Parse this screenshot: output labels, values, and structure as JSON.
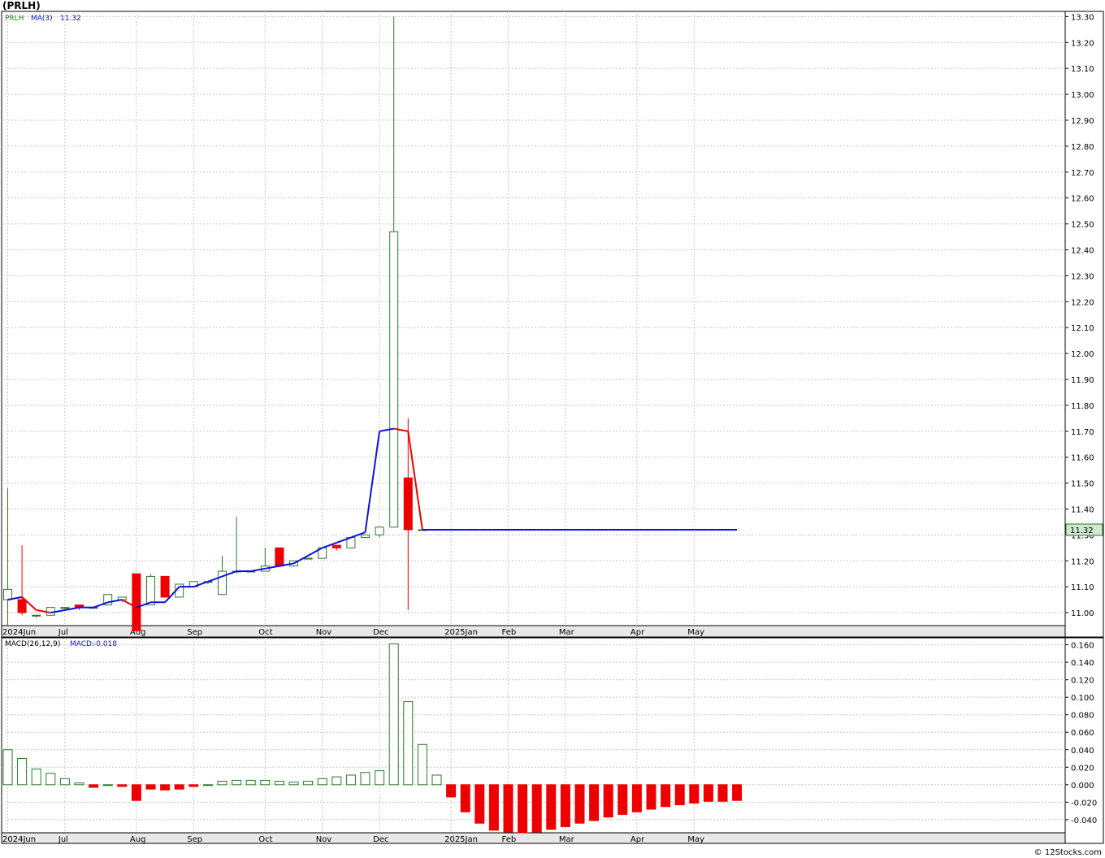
{
  "title": "(PRLH)",
  "footer": "© 12Stocks.com",
  "colors": {
    "up": "#2a7a2a",
    "down": "#ee0000",
    "ma_up": "#1010dd",
    "ma_down": "#ee0000",
    "grid": "#c8c8c8",
    "axis_bg": "#e8e8e8"
  },
  "price_legend": {
    "symbol": "PRLH",
    "ma": "MA(3)",
    "ma_value": "11.32"
  },
  "macd_legend": {
    "params": "MACD(26,12,9)",
    "label": "MACD:",
    "value": "-0.018"
  },
  "last_price_label": "11.32",
  "x_labels": [
    {
      "t": "2024Jun",
      "i": 0
    },
    {
      "t": "Jul",
      "i": 4
    },
    {
      "t": "Aug",
      "i": 9
    },
    {
      "t": "Sep",
      "i": 13
    },
    {
      "t": "Oct",
      "i": 18
    },
    {
      "t": "Nov",
      "i": 22
    },
    {
      "t": "Dec",
      "i": 26
    },
    {
      "t": "2025Jan",
      "i": 31
    },
    {
      "t": "Feb",
      "i": 35
    },
    {
      "t": "Mar",
      "i": 39
    },
    {
      "t": "Apr",
      "i": 44
    },
    {
      "t": "May",
      "i": 48
    }
  ],
  "chart_data": [
    {
      "type": "candlestick",
      "name": "price",
      "ylim": [
        10.95,
        13.32
      ],
      "yticks": [
        "11.00",
        "11.10",
        "11.20",
        "11.30",
        "11.40",
        "11.50",
        "11.60",
        "11.70",
        "11.80",
        "11.90",
        "12.00",
        "12.10",
        "12.20",
        "12.30",
        "12.40",
        "12.50",
        "12.60",
        "12.70",
        "12.80",
        "12.90",
        "13.00",
        "13.10",
        "13.20",
        "13.30"
      ],
      "candles": [
        {
          "i": 0,
          "o": 11.05,
          "h": 11.48,
          "l": 10.95,
          "c": 11.09
        },
        {
          "i": 1,
          "o": 11.05,
          "h": 11.26,
          "l": 10.99,
          "c": 11.0
        },
        {
          "i": 2,
          "o": 10.99,
          "h": 10.99,
          "l": 10.98,
          "c": 10.99
        },
        {
          "i": 3,
          "o": 10.99,
          "h": 11.02,
          "l": 10.99,
          "c": 11.02
        },
        {
          "i": 4,
          "o": 11.02,
          "h": 11.02,
          "l": 11.01,
          "c": 11.02
        },
        {
          "i": 5,
          "o": 11.03,
          "h": 11.03,
          "l": 11.01,
          "c": 11.02
        },
        {
          "i": 6,
          "o": 11.02,
          "h": 11.02,
          "l": 11.02,
          "c": 11.02
        },
        {
          "i": 7,
          "o": 11.03,
          "h": 11.07,
          "l": 11.03,
          "c": 11.07
        },
        {
          "i": 8,
          "o": 11.05,
          "h": 11.06,
          "l": 11.04,
          "c": 11.06
        },
        {
          "i": 9,
          "o": 11.15,
          "h": 11.15,
          "l": 10.93,
          "c": 10.93
        },
        {
          "i": 10,
          "o": 11.03,
          "h": 11.15,
          "l": 11.03,
          "c": 11.14
        },
        {
          "i": 11,
          "o": 11.14,
          "h": 11.14,
          "l": 11.06,
          "c": 11.06
        },
        {
          "i": 12,
          "o": 11.06,
          "h": 11.11,
          "l": 11.06,
          "c": 11.11
        },
        {
          "i": 13,
          "o": 11.1,
          "h": 11.12,
          "l": 11.1,
          "c": 11.12
        },
        {
          "i": 14,
          "o": 11.12,
          "h": 11.12,
          "l": 11.11,
          "c": 11.12
        },
        {
          "i": 15,
          "o": 11.07,
          "h": 11.22,
          "l": 11.07,
          "c": 11.16
        },
        {
          "i": 16,
          "o": 11.16,
          "h": 11.37,
          "l": 11.15,
          "c": 11.16
        },
        {
          "i": 17,
          "o": 11.16,
          "h": 11.16,
          "l": 11.16,
          "c": 11.16
        },
        {
          "i": 18,
          "o": 11.16,
          "h": 11.25,
          "l": 11.16,
          "c": 11.18
        },
        {
          "i": 19,
          "o": 11.25,
          "h": 11.25,
          "l": 11.18,
          "c": 11.18
        },
        {
          "i": 20,
          "o": 11.18,
          "h": 11.2,
          "l": 11.18,
          "c": 11.2
        },
        {
          "i": 21,
          "o": 11.21,
          "h": 11.21,
          "l": 11.21,
          "c": 11.21
        },
        {
          "i": 22,
          "o": 11.21,
          "h": 11.25,
          "l": 11.21,
          "c": 11.25
        },
        {
          "i": 23,
          "o": 11.26,
          "h": 11.26,
          "l": 11.24,
          "c": 11.25
        },
        {
          "i": 24,
          "o": 11.25,
          "h": 11.29,
          "l": 11.25,
          "c": 11.29
        },
        {
          "i": 25,
          "o": 11.29,
          "h": 11.3,
          "l": 11.29,
          "c": 11.3
        },
        {
          "i": 26,
          "o": 11.3,
          "h": 11.33,
          "l": 11.29,
          "c": 11.33
        },
        {
          "i": 27,
          "o": 11.33,
          "h": 13.3,
          "l": 11.33,
          "c": 12.47
        },
        {
          "i": 28,
          "o": 11.52,
          "h": 11.75,
          "l": 11.01,
          "c": 11.32
        },
        {
          "i": 29,
          "o": 11.32,
          "h": 11.32,
          "l": 11.32,
          "c": 11.32
        }
      ],
      "ma3": [
        11.05,
        11.06,
        11.01,
        11.0,
        11.01,
        11.02,
        11.02,
        11.04,
        11.05,
        11.02,
        11.04,
        11.04,
        11.1,
        11.1,
        11.12,
        11.14,
        11.16,
        11.16,
        11.17,
        11.18,
        11.19,
        11.22,
        11.25,
        11.27,
        11.29,
        11.31,
        11.7,
        11.71,
        11.7,
        11.32,
        11.32,
        11.32,
        11.32,
        11.32,
        11.32,
        11.32,
        11.32,
        11.32,
        11.32,
        11.32,
        11.32,
        11.32,
        11.32,
        11.32,
        11.32,
        11.32,
        11.32,
        11.32,
        11.32,
        11.32,
        11.32,
        11.32
      ]
    },
    {
      "type": "bar",
      "name": "MACD",
      "ylim": [
        -0.055,
        0.168
      ],
      "yticks": [
        "0.160",
        "0.140",
        "0.120",
        "0.100",
        "0.080",
        "0.060",
        "0.040",
        "0.020",
        "0.000",
        "-0.020",
        "-0.040"
      ],
      "values": [
        0.04,
        0.03,
        0.018,
        0.013,
        0.007,
        0.002,
        -0.003,
        0.0,
        -0.002,
        -0.018,
        -0.005,
        -0.006,
        -0.005,
        -0.002,
        0.0,
        0.004,
        0.005,
        0.005,
        0.005,
        0.004,
        0.003,
        0.004,
        0.007,
        0.009,
        0.011,
        0.014,
        0.016,
        0.161,
        0.095,
        0.046,
        0.011,
        -0.014,
        -0.031,
        -0.044,
        -0.052,
        -0.054,
        -0.055,
        -0.054,
        -0.051,
        -0.048,
        -0.044,
        -0.041,
        -0.037,
        -0.034,
        -0.031,
        -0.028,
        -0.025,
        -0.023,
        -0.021,
        -0.019,
        -0.019,
        -0.018
      ]
    }
  ]
}
